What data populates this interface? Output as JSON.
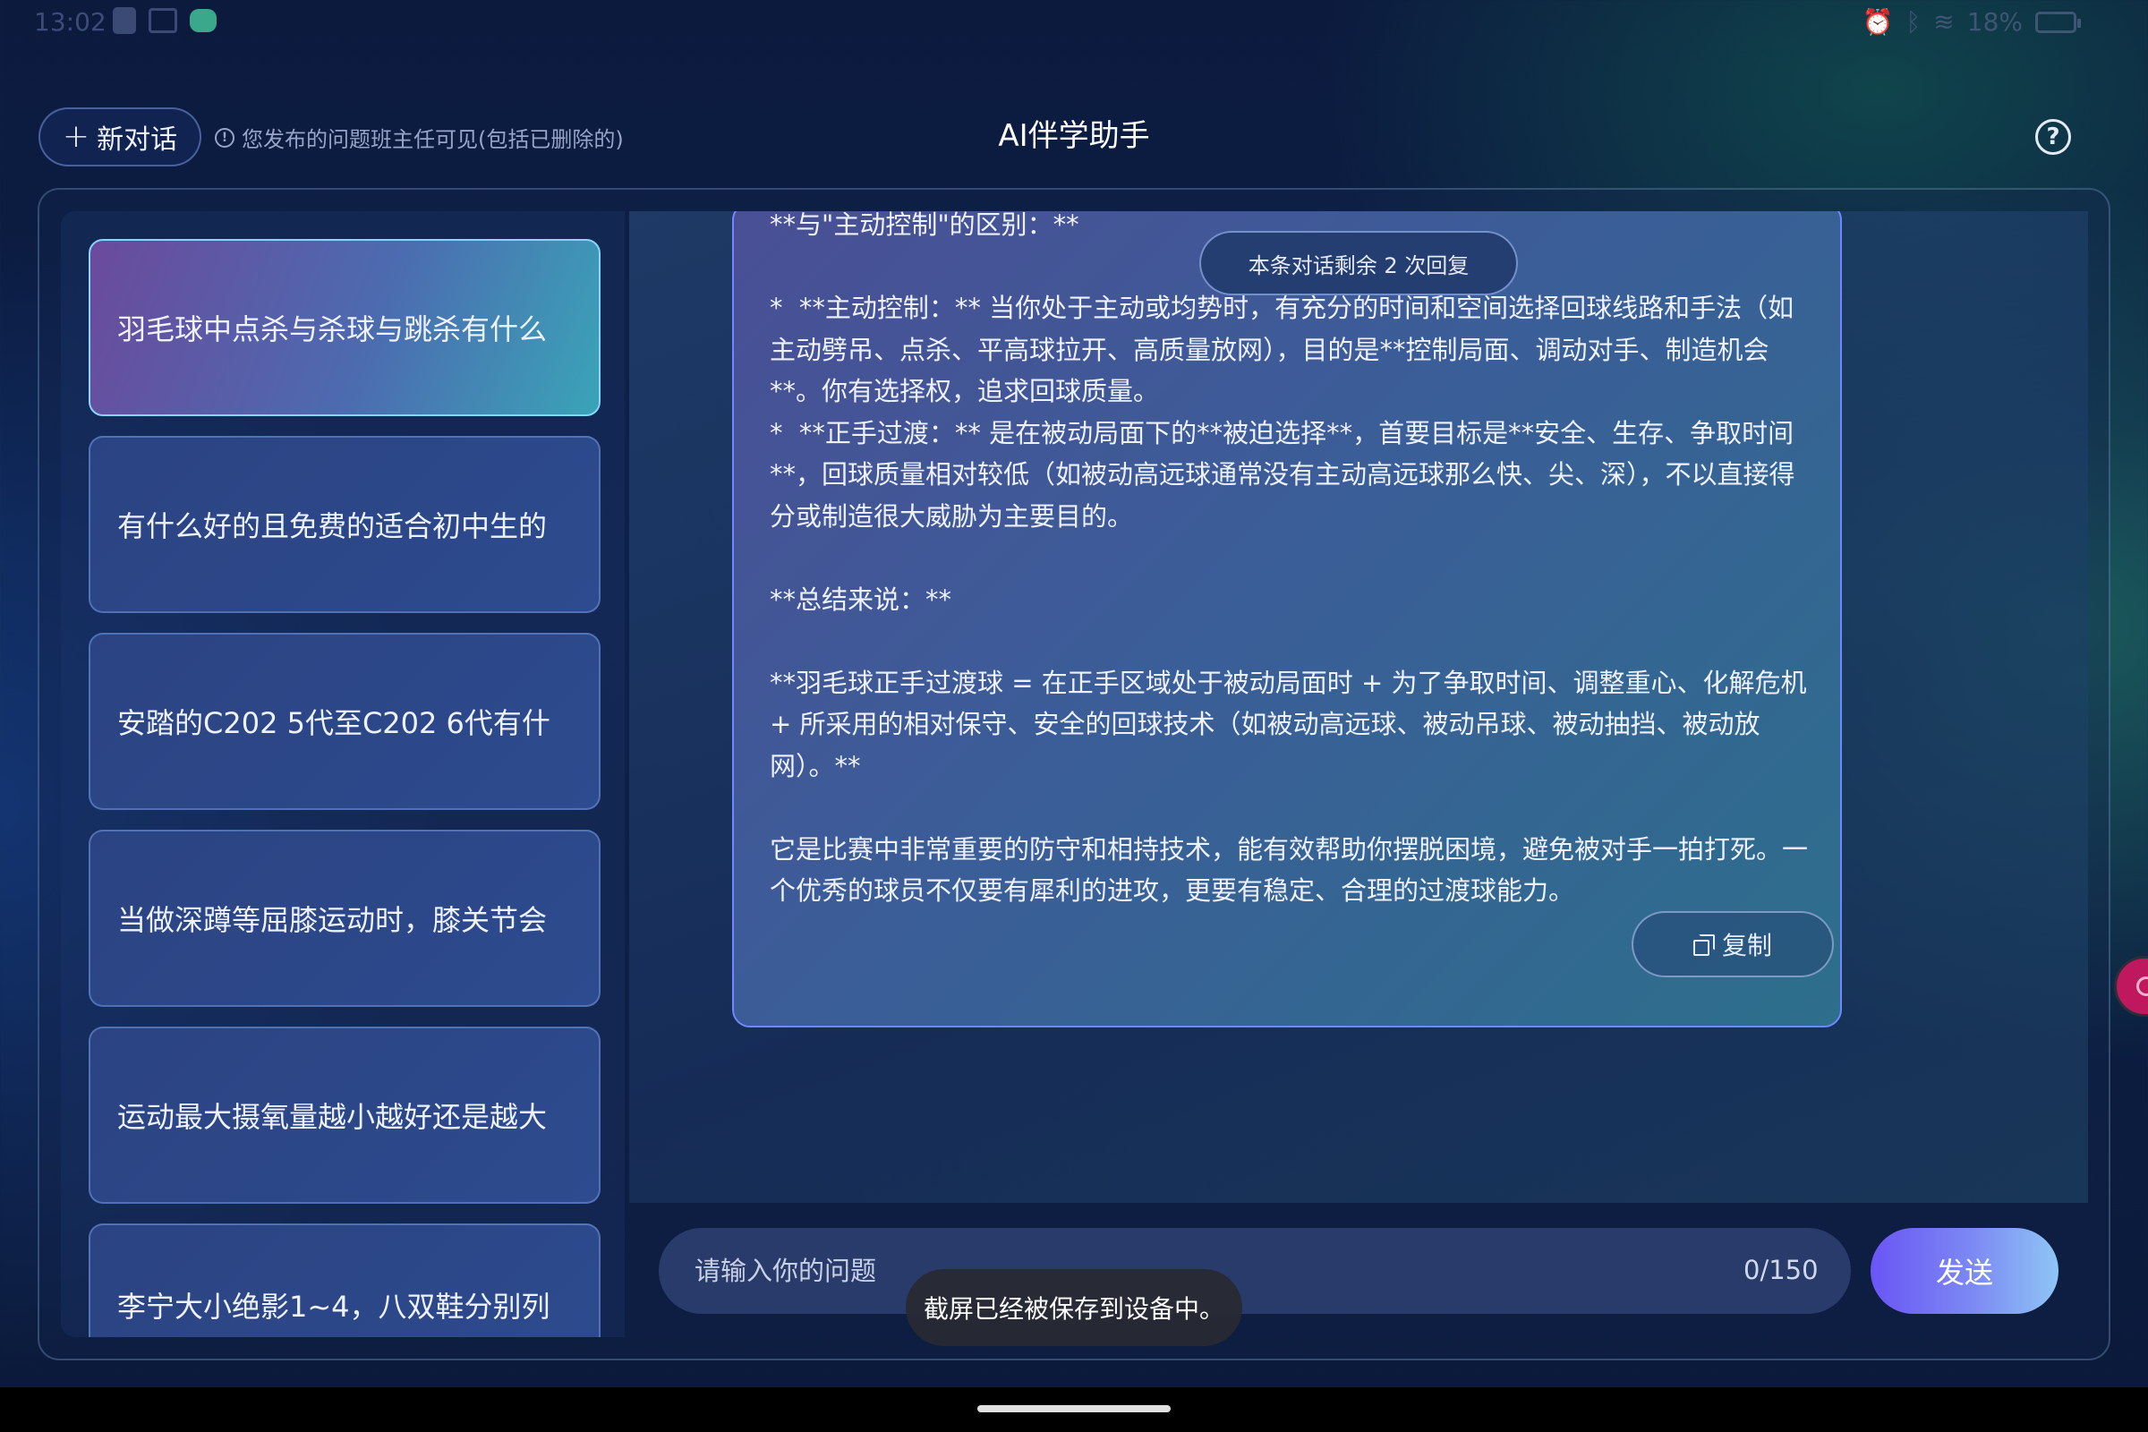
{
  "status_bar": {
    "time": "13:02",
    "battery": "18%"
  },
  "header": {
    "new_chat_label": "新对话",
    "notice": "您发布的问题班主任可见(包括已删除的)",
    "title": "AI伴学助手",
    "help_symbol": "?"
  },
  "sidebar": {
    "items": [
      {
        "label": "羽毛球中点杀与杀球与跳杀有什么",
        "active": true
      },
      {
        "label": "有什么好的且免费的适合初中生的",
        "active": false
      },
      {
        "label": "安踏的C202 5代至C202 6代有什",
        "active": false
      },
      {
        "label": "当做深蹲等屈膝运动时，膝关节会",
        "active": false
      },
      {
        "label": "运动最大摄氧量越小越好还是越大",
        "active": false
      },
      {
        "label": "李宁大小绝影1~4，八双鞋分别列",
        "active": false
      }
    ]
  },
  "chat": {
    "remaining_badge": "本条对话剩余 2 次回复",
    "message": "**与\"主动控制\"的区别：**\n\n*  **主动控制：** 当你处于主动或均势时，有充分的时间和空间选择回球线路和手法（如主动劈吊、点杀、平高球拉开、高质量放网），目的是**控制局面、调动对手、制造机会**。你有选择权，追求回球质量。\n*  **正手过渡：** 是在被动局面下的**被迫选择**，首要目标是**安全、生存、争取时间**，回球质量相对较低（如被动高远球通常没有主动高远球那么快、尖、深），不以直接得分或制造很大威胁为主要目的。\n\n**总结来说：**\n\n**羽毛球正手过渡球 = 在正手区域处于被动局面时 + 为了争取时间、调整重心、化解危机 + 所采用的相对保守、安全的回球技术（如被动高远球、被动吊球、被动抽挡、被动放网）。**\n\n它是比赛中非常重要的防守和相持技术，能有效帮助你摆脱困境，避免被对手一拍打死。一个优秀的球员不仅要有犀利的进攻，更要有稳定、合理的过渡球能力。",
    "copy_label": "复制"
  },
  "input": {
    "placeholder": "请输入你的问题",
    "value": "",
    "char_count": "0/150",
    "send_label": "发送"
  },
  "toast": {
    "text": "截屏已经被保存到设备中。"
  }
}
